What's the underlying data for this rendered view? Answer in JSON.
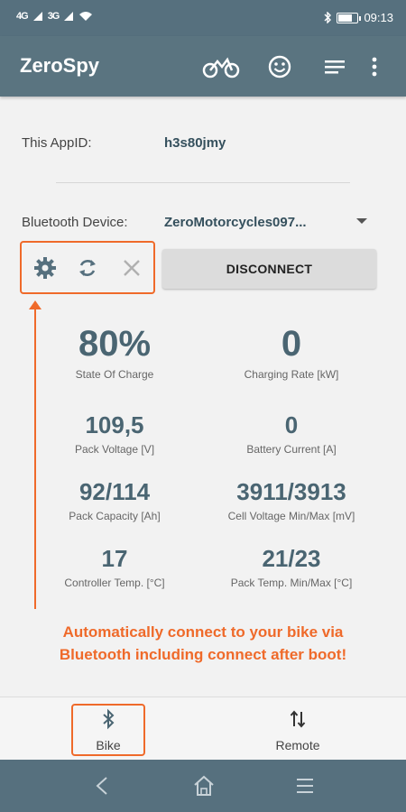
{
  "status_bar": {
    "signal_1": "4G",
    "signal_2": "3G",
    "time": "09:13"
  },
  "app_bar": {
    "title": "ZeroSpy",
    "icons": [
      "bike-icon",
      "smiley-icon",
      "list-icon",
      "overflow-menu-icon"
    ]
  },
  "app_id": {
    "label": "This AppID:",
    "value": "h3s80jmy"
  },
  "bluetooth": {
    "label": "Bluetooth Device:",
    "value": "ZeroMotorcycles097..."
  },
  "tools": [
    "settings-icon",
    "refresh-icon",
    "close-icon"
  ],
  "disconnect_label": "DISCONNECT",
  "stats": {
    "soc": {
      "value": "80%",
      "label": "State Of Charge"
    },
    "charging_rate": {
      "value": "0",
      "label": "Charging Rate [kW]"
    },
    "pack_voltage": {
      "value": "109,5",
      "label": "Pack Voltage [V]"
    },
    "battery_current": {
      "value": "0",
      "label": "Battery Current [A]"
    },
    "pack_capacity": {
      "value": "92/114",
      "label": "Pack Capacity [Ah]"
    },
    "cell_voltage": {
      "value": "3911/3913",
      "label": "Cell Voltage Min/Max [mV]"
    },
    "controller_temp": {
      "value": "17",
      "label": "Controller Temp. [°C]"
    },
    "pack_temp": {
      "value": "21/23",
      "label": "Pack Temp. Min/Max [°C]"
    }
  },
  "promo": {
    "line1": "Automatically connect to your bike via",
    "line2": "Bluetooth including connect after boot!"
  },
  "bottom_nav": {
    "bike": "Bike",
    "remote": "Remote"
  },
  "colors": {
    "app_bar": "#5a7480",
    "accent": "#ef6a2a",
    "value_text": "#4a6572"
  }
}
